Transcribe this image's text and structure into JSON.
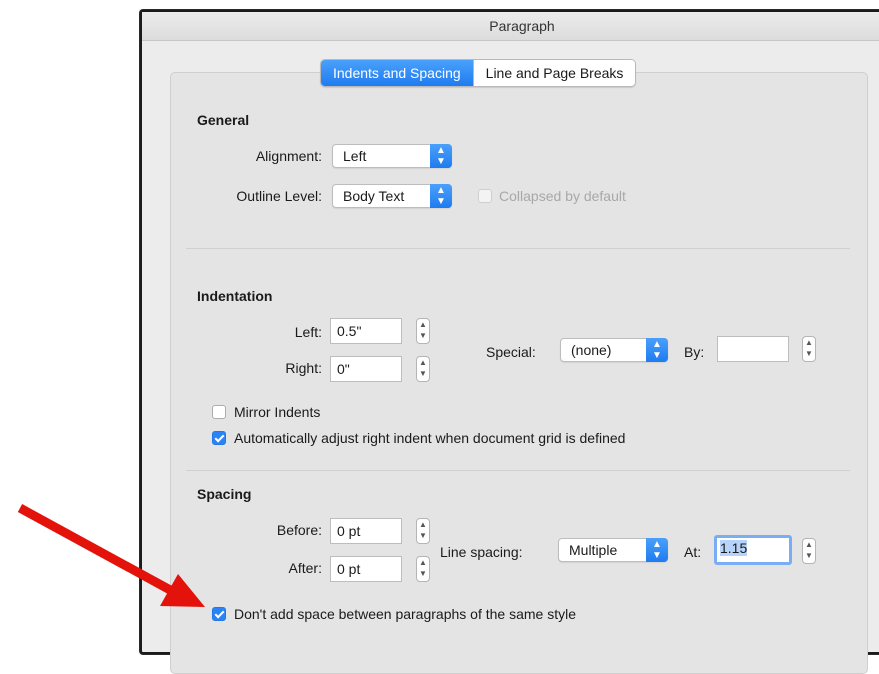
{
  "window": {
    "title": "Paragraph"
  },
  "tabs": [
    {
      "label": "Indents and Spacing",
      "active": true
    },
    {
      "label": "Line and Page Breaks",
      "active": false
    }
  ],
  "general": {
    "heading": "General",
    "alignment_label": "Alignment:",
    "alignment_value": "Left",
    "outline_label": "Outline Level:",
    "outline_value": "Body Text",
    "collapsed_label": "Collapsed by default",
    "collapsed_checked": false
  },
  "indentation": {
    "heading": "Indentation",
    "left_label": "Left:",
    "left_value": "0.5\"",
    "right_label": "Right:",
    "right_value": "0\"",
    "special_label": "Special:",
    "special_value": "(none)",
    "by_label": "By:",
    "by_value": "",
    "mirror_label": "Mirror Indents",
    "mirror_checked": false,
    "auto_adjust_label": "Automatically adjust right indent when document grid is defined",
    "auto_adjust_checked": true
  },
  "spacing": {
    "heading": "Spacing",
    "before_label": "Before:",
    "before_value": "0 pt",
    "after_label": "After:",
    "after_value": "0 pt",
    "line_spacing_label": "Line spacing:",
    "line_spacing_value": "Multiple",
    "at_label": "At:",
    "at_value": "1.15",
    "dont_add_space_label": "Don't add space between paragraphs of the same style",
    "dont_add_space_checked": true
  },
  "colors": {
    "accent": "#1f7cf0",
    "annotation_arrow": "#e3120b"
  }
}
